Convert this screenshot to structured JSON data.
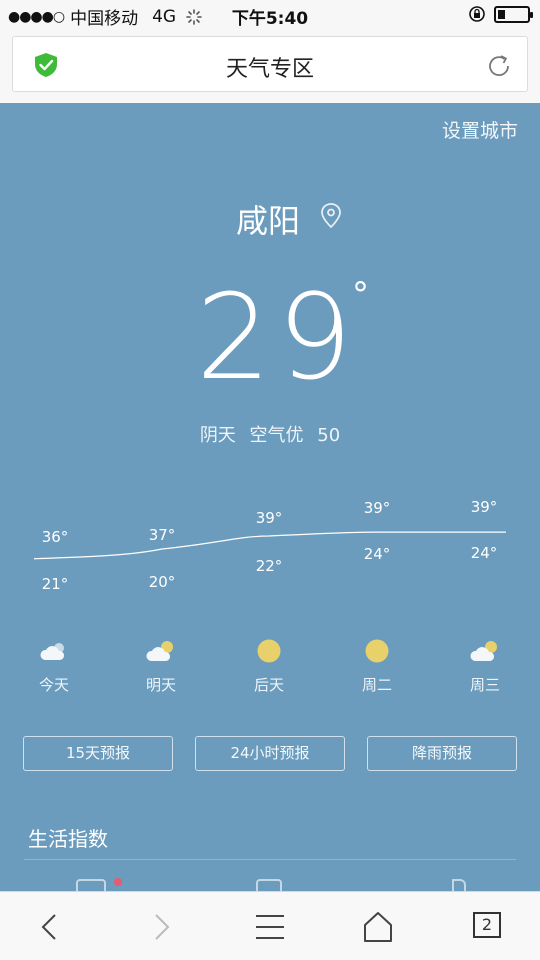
{
  "status_bar": {
    "signal": "●●●●○",
    "carrier": "中国移动",
    "network": "4G",
    "time": "下午5:40",
    "battery_level": 0.25
  },
  "address_bar": {
    "title": "天气专区",
    "security_icon": "shield-check-icon",
    "refresh_icon": "refresh-icon"
  },
  "weather": {
    "set_city_label": "设置城市",
    "city": "咸阳",
    "location_icon": "location-pin-icon",
    "temperature": "29",
    "degree_symbol": "°",
    "condition": "阴天",
    "air_quality": "空气优",
    "aqi": "50"
  },
  "chart_data": {
    "type": "line",
    "categories": [
      "今天",
      "明天",
      "后天",
      "周二",
      "周三"
    ],
    "series": [
      {
        "values": [
          36,
          37,
          39,
          39,
          39
        ]
      },
      {
        "values": [
          21,
          20,
          22,
          24,
          24
        ]
      }
    ],
    "high_labels": [
      "36°",
      "37°",
      "39°",
      "39°",
      "39°"
    ],
    "low_labels": [
      "21°",
      "20°",
      "22°",
      "24°",
      "24°"
    ],
    "curve_values": [
      36,
      37,
      39,
      39.6,
      39.6
    ]
  },
  "days": [
    {
      "label": "今天",
      "icon": "cloudy-icon"
    },
    {
      "label": "明天",
      "icon": "partly-cloudy-icon"
    },
    {
      "label": "后天",
      "icon": "sunny-icon"
    },
    {
      "label": "周二",
      "icon": "sunny-icon"
    },
    {
      "label": "周三",
      "icon": "partly-cloudy-icon"
    }
  ],
  "forecast_buttons": [
    "15天预报",
    "24小时预报",
    "降雨预报"
  ],
  "life_section": {
    "title": "生活指数"
  },
  "toolbar": {
    "back_icon": "back-icon",
    "forward_icon": "forward-icon",
    "menu_icon": "menu-icon",
    "home_icon": "home-icon",
    "tab_count": "2"
  },
  "colors": {
    "panel": "#6b9cbd",
    "sun": "#e8d06a",
    "badge": "#e85a70"
  }
}
